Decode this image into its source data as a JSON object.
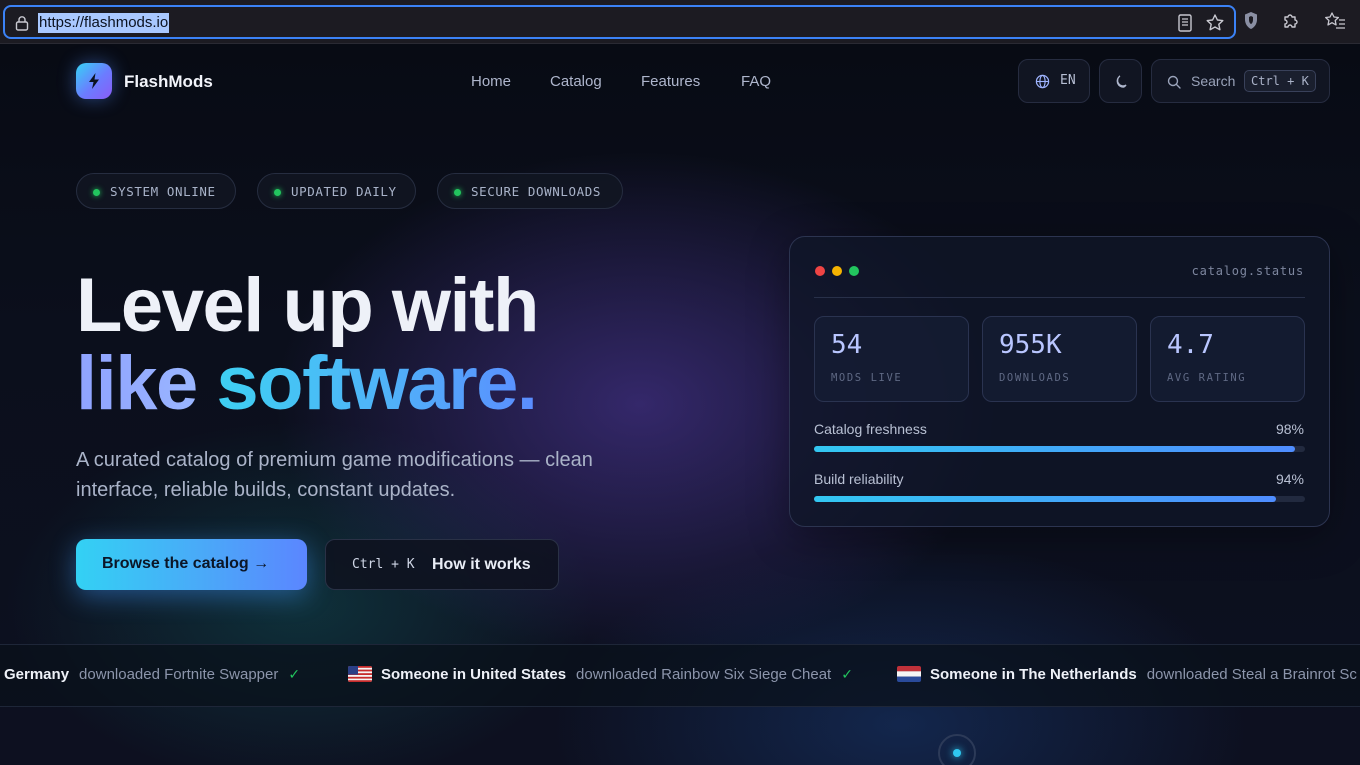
{
  "browser": {
    "url": "https://flashmods.io",
    "icons": [
      "lock-icon",
      "reader-mode-icon",
      "bookmark-star-icon",
      "shield-icon",
      "extensions-icon",
      "bookmarks-list-icon"
    ]
  },
  "nav": {
    "brand": "FlashMods",
    "links": [
      "Home",
      "Catalog",
      "Features",
      "FAQ"
    ],
    "lang": "EN",
    "search_label": "Search",
    "search_shortcut": "Ctrl + K"
  },
  "status_chips": [
    "SYSTEM ONLINE",
    "UPDATED DAILY",
    "SECURE DOWNLOADS"
  ],
  "hero": {
    "line1": "Level up with",
    "line2_a": "like",
    "line2_b": "software.",
    "subtitle": "A curated catalog of premium game modifications — clean interface, reliable builds, constant updates.",
    "cta_primary": "Browse the catalog →",
    "cta_secondary_kbd": "Ctrl + K",
    "cta_secondary": "How it works"
  },
  "status_card": {
    "title": "catalog.status",
    "stats": [
      {
        "value": "54",
        "label": "MODS LIVE"
      },
      {
        "value": "955K",
        "label": "DOWNLOADS"
      },
      {
        "value": "4.7",
        "label": "AVG RATING"
      }
    ],
    "bars": [
      {
        "label": "Catalog freshness",
        "value_text": "98%",
        "value": 0.98
      },
      {
        "label": "Build reliability",
        "value_text": "94%",
        "value": 0.94
      }
    ],
    "colors": {
      "dot_red": "#ef4444",
      "dot_yellow": "#f5b301",
      "dot_green": "#22c55e"
    }
  },
  "ticker": [
    {
      "who": "Germany",
      "what": "downloaded Fortnite Swapper",
      "check": "✓"
    },
    {
      "who": "Someone in United States",
      "what": "downloaded Rainbow Six Siege Cheat",
      "check": "✓"
    },
    {
      "who": "Someone in The Netherlands",
      "what": "downloaded Steal a Brainrot Sc"
    }
  ],
  "colors": {
    "accent": "#3ed0f2",
    "accent2": "#5b86ff",
    "online": "#22c55e"
  }
}
